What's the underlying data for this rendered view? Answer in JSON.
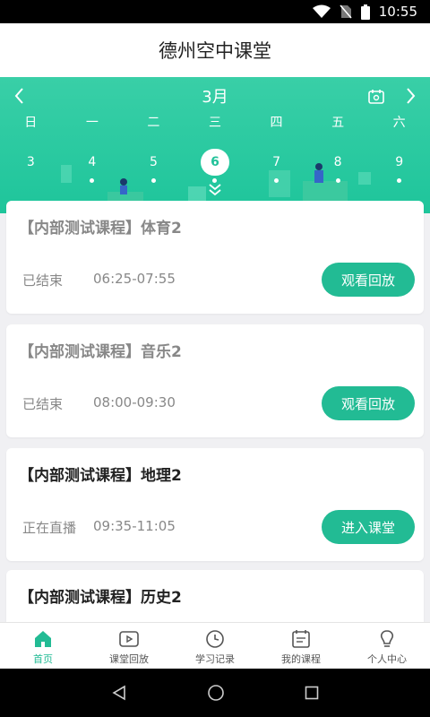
{
  "status_bar": {
    "time": "10:55"
  },
  "app_bar": {
    "title": "德州空中课堂"
  },
  "calendar": {
    "month": "3月",
    "weekdays": [
      "日",
      "一",
      "二",
      "三",
      "四",
      "五",
      "六"
    ],
    "dates": [
      {
        "label": "3",
        "has_class": false,
        "selected": false
      },
      {
        "label": "4",
        "has_class": true,
        "selected": false
      },
      {
        "label": "5",
        "has_class": true,
        "selected": false
      },
      {
        "label": "6",
        "has_class": true,
        "selected": true
      },
      {
        "label": "7",
        "has_class": true,
        "selected": false
      },
      {
        "label": "8",
        "has_class": true,
        "selected": false
      },
      {
        "label": "9",
        "has_class": true,
        "selected": false
      }
    ]
  },
  "courses": [
    {
      "title": "【内部测试课程】体育2",
      "status": "已结束",
      "time": "06:25-07:55",
      "button": "观看回放",
      "ended": true
    },
    {
      "title": "【内部测试课程】音乐2",
      "status": "已结束",
      "time": "08:00-09:30",
      "button": "观看回放",
      "ended": true
    },
    {
      "title": "【内部测试课程】地理2",
      "status": "正在直播",
      "time": "09:35-11:05",
      "button": "进入课堂",
      "ended": false
    },
    {
      "title": "【内部测试课程】历史2",
      "status": "",
      "time": "",
      "button": "",
      "ended": false
    }
  ],
  "tabs": [
    {
      "label": "首页",
      "icon": "home-icon",
      "active": true
    },
    {
      "label": "课堂回放",
      "icon": "play-video-icon",
      "active": false
    },
    {
      "label": "学习记录",
      "icon": "clock-icon",
      "active": false
    },
    {
      "label": "我的课程",
      "icon": "calendar-list-icon",
      "active": false
    },
    {
      "label": "个人中心",
      "icon": "bulb-person-icon",
      "active": false
    }
  ],
  "colors": {
    "accent": "#22bb94",
    "calendar_bg": "#2fcaa2"
  }
}
